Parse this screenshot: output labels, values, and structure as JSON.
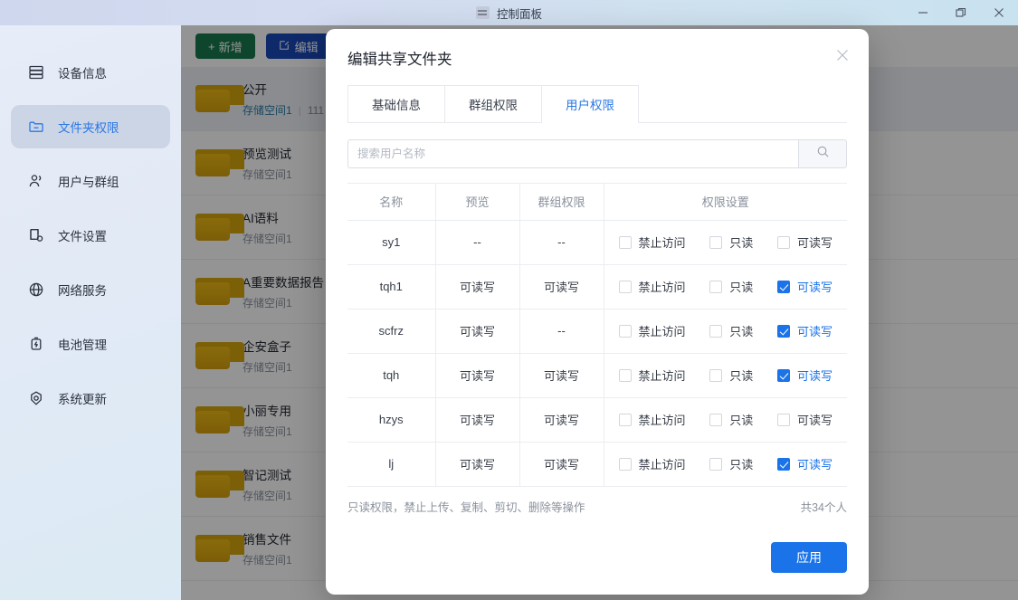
{
  "window": {
    "title": "控制面板",
    "app_icon": "panel-icon",
    "controls": [
      {
        "name": "minimize-button",
        "icon": "minimize-icon"
      },
      {
        "name": "restore-button",
        "icon": "restore-icon"
      },
      {
        "name": "close-button",
        "icon": "close-icon"
      }
    ]
  },
  "sidebar": {
    "items": [
      {
        "label": "设备信息",
        "icon": "server-icon",
        "active": false
      },
      {
        "label": "文件夹权限",
        "icon": "folder-permission-icon",
        "active": true
      },
      {
        "label": "用户与群组",
        "icon": "users-icon",
        "active": false
      },
      {
        "label": "文件设置",
        "icon": "file-settings-icon",
        "active": false
      },
      {
        "label": "网络服务",
        "icon": "globe-icon",
        "active": false
      },
      {
        "label": "电池管理",
        "icon": "battery-icon",
        "active": false
      },
      {
        "label": "系统更新",
        "icon": "update-icon",
        "active": false
      }
    ]
  },
  "main": {
    "toolbar": {
      "add_label": "新增",
      "add_icon": "plus-icon",
      "edit_label": "编辑",
      "edit_icon": "pencil-icon"
    },
    "folders": [
      {
        "name": "公开",
        "space": "存储空间1",
        "size": "111",
        "selected": true
      },
      {
        "name": "预览测试",
        "space": "存储空间1",
        "size": "",
        "selected": false
      },
      {
        "name": "AI语料",
        "space": "存储空间1",
        "size": "",
        "selected": false
      },
      {
        "name": "A重要数据报告",
        "space": "存储空间1",
        "size": "",
        "selected": false
      },
      {
        "name": "企安盒子",
        "space": "存储空间1",
        "size": "",
        "selected": false
      },
      {
        "name": "小丽专用",
        "space": "存储空间1",
        "size": "",
        "selected": false
      },
      {
        "name": "智记测试",
        "space": "存储空间1",
        "size": "",
        "selected": false
      },
      {
        "name": "销售文件",
        "space": "存储空间1",
        "size": "",
        "selected": false
      }
    ]
  },
  "dialog": {
    "title": "编辑共享文件夹",
    "close_icon": "close-icon",
    "tabs": [
      {
        "label": "基础信息",
        "active": false
      },
      {
        "label": "群组权限",
        "active": false
      },
      {
        "label": "用户权限",
        "active": true
      }
    ],
    "search": {
      "placeholder": "搜索用户名称",
      "value": "",
      "button_icon": "search-icon"
    },
    "table": {
      "headers": [
        "名称",
        "预览",
        "群组权限",
        "权限设置"
      ],
      "permission_options": [
        "禁止访问",
        "只读",
        "可读写"
      ],
      "rows": [
        {
          "name": "sy1",
          "preview": "--",
          "group": "--",
          "checked": [
            false,
            false,
            false
          ]
        },
        {
          "name": "tqh1",
          "preview": "可读写",
          "group": "可读写",
          "checked": [
            false,
            false,
            true
          ]
        },
        {
          "name": "scfrz",
          "preview": "可读写",
          "group": "--",
          "checked": [
            false,
            false,
            true
          ]
        },
        {
          "name": "tqh",
          "preview": "可读写",
          "group": "可读写",
          "checked": [
            false,
            false,
            true
          ]
        },
        {
          "name": "hzys",
          "preview": "可读写",
          "group": "可读写",
          "checked": [
            false,
            false,
            false
          ]
        },
        {
          "name": "lj",
          "preview": "可读写",
          "group": "可读写",
          "checked": [
            false,
            false,
            true
          ]
        }
      ]
    },
    "footer_hint": "只读权限，禁止上传、复制、剪切、删除等操作",
    "footer_count": "共34个人",
    "apply_label": "应用"
  },
  "colors": {
    "accent_blue": "#1a73e8",
    "link_blue": "#3a9ad9",
    "tab_active": "#2b78e4",
    "add_green": "#18794e",
    "edit_blue": "#1a49b8",
    "folder_yellow": "#ecb916"
  }
}
